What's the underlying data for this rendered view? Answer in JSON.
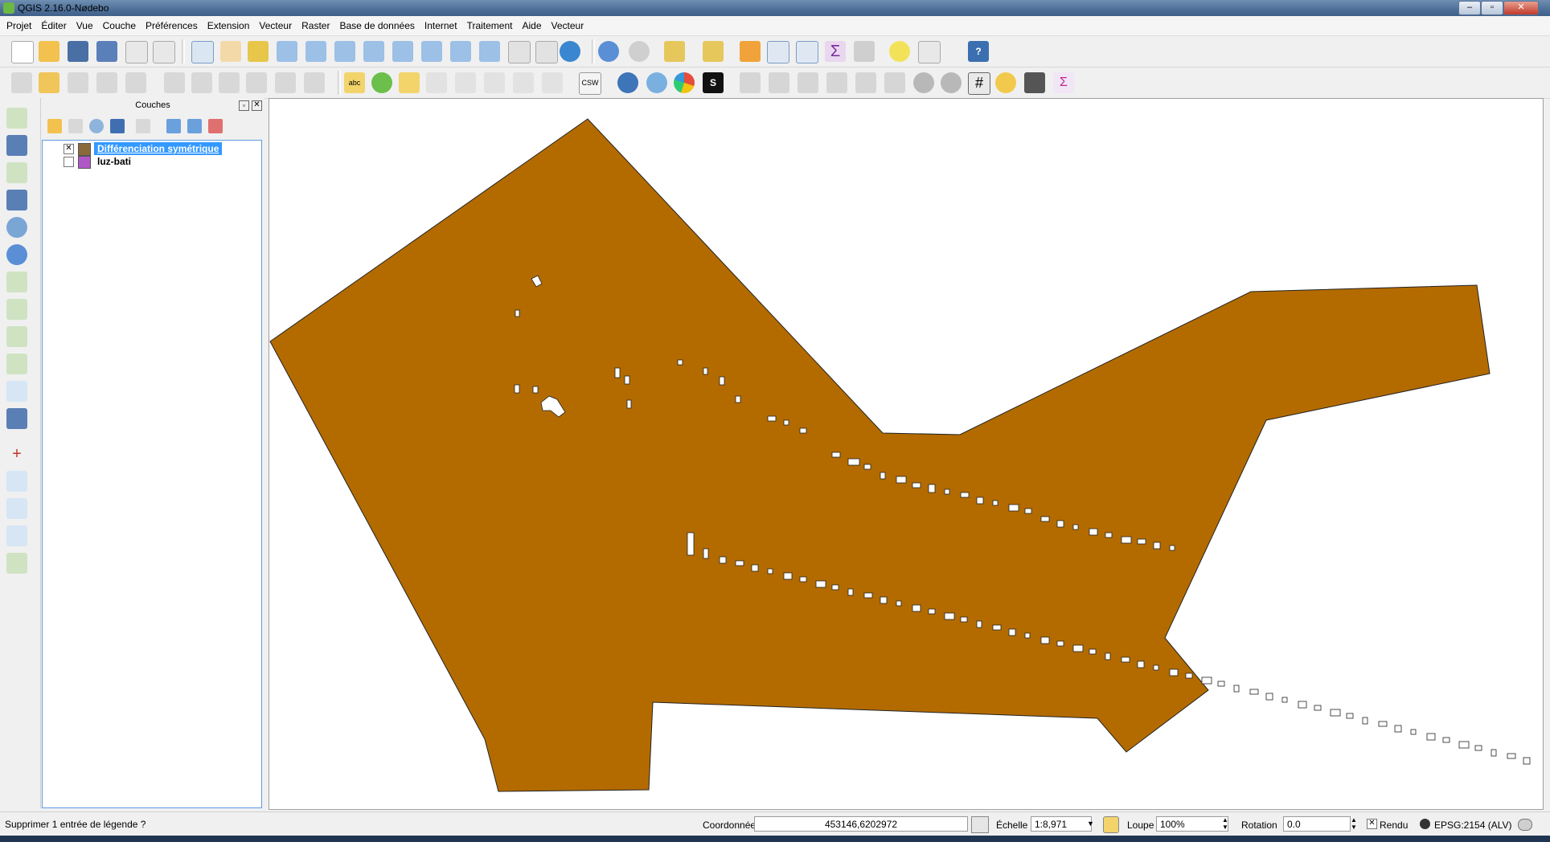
{
  "window": {
    "title": "QGIS 2.16.0-Nødebo"
  },
  "menu": [
    "Projet",
    "Éditer",
    "Vue",
    "Couche",
    "Préférences",
    "Extension",
    "Vecteur",
    "Raster",
    "Base de données",
    "Internet",
    "Traitement",
    "Aide",
    "Vecteur"
  ],
  "toolbar2": {
    "csw_label": "CSW"
  },
  "layers_panel": {
    "title": "Couches",
    "layers": [
      {
        "name": "Différenciation symétrique",
        "checked": true,
        "selected": true,
        "color": "#8a6a3a"
      },
      {
        "name": "luz-bati",
        "checked": false,
        "selected": false,
        "color": "#b057c8"
      }
    ]
  },
  "map": {
    "fill_color": "#b36b00",
    "stroke_color": "#222222",
    "hole_color": "#ffffff"
  },
  "status": {
    "message": "Supprimer 1 entrée de légende ?",
    "coord_label": "Coordonnée",
    "coord_value": "453146,6202972",
    "scale_label": "Échelle",
    "scale_value": "1:8,971",
    "zoom_label": "Loupe",
    "zoom_value": "100%",
    "rotation_label": "Rotation",
    "rotation_value": "0.0",
    "render_label": "Rendu",
    "crs_label": "EPSG:2154 (ALV)"
  }
}
